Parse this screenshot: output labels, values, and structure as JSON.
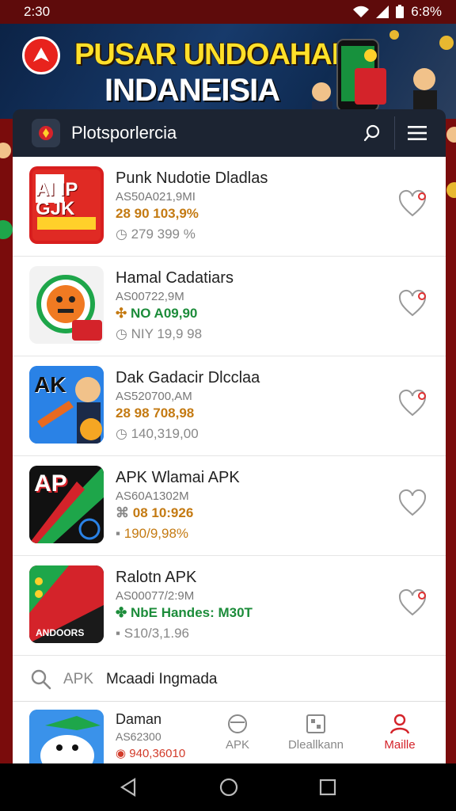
{
  "status_bar": {
    "time": "2:30",
    "battery": "6:8%"
  },
  "banner": {
    "title_line1": "PUSAR UNDOAHAN",
    "title_line2": "INDANEISIA"
  },
  "header": {
    "title": "Plotsporlercia"
  },
  "apps": [
    {
      "name": "Punk Nudotie Dladlas",
      "meta": "AS50A021,9MI",
      "price": "28 90 103,9%",
      "price_color": "#c47a12",
      "rating": "279 399 %",
      "thumb_text": "AI IP GJK"
    },
    {
      "name": "Hamal Cadatiars",
      "meta": "AS00722,9M",
      "price": "NO A09,90",
      "price_color": "#1c8c3a",
      "rating": "NIY 19,9 98",
      "thumb_text": ""
    },
    {
      "name": "Dak Gadacir Dlcclaa",
      "meta": "AS520700,AM",
      "price": "28 98 708,98",
      "price_color": "#c47a12",
      "rating": "140,319,00",
      "thumb_text": "AK"
    },
    {
      "name": "APK Wlamai APK",
      "meta": "AS60A1302M",
      "price": "08 10:926",
      "price_color": "#c47a12",
      "rating": "190/9,98%",
      "thumb_text": "AP"
    },
    {
      "name": "Ralotn APK",
      "meta": "AS00077/2:9M",
      "price": "NbE Handes: M30T",
      "price_color": "#1c8c3a",
      "rating": "S10/3,1.96",
      "thumb_text": "ANDOORS"
    }
  ],
  "search": {
    "prefix": "APK",
    "value": "Mcaadi Ingmada"
  },
  "partial_app": {
    "name": "Daman",
    "meta": "AS62300",
    "price": "940,36010"
  },
  "bottom_nav": [
    {
      "label": "APK",
      "icon": "globe-icon"
    },
    {
      "label": "Dleallkann",
      "icon": "grid-icon"
    },
    {
      "label": "Maille",
      "icon": "person-icon"
    }
  ],
  "colors": {
    "accent": "#d4232a",
    "header_bg": "#1c2432",
    "frame": "#7a0c0c"
  }
}
